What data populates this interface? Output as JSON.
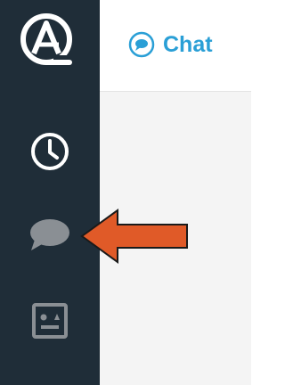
{
  "header": {
    "title": "Chat"
  },
  "sidebar": {
    "items": [
      {
        "icon": "clock-icon",
        "active": false
      },
      {
        "icon": "chat-bubble-icon",
        "active": true
      },
      {
        "icon": "contact-card-icon",
        "active": false
      }
    ]
  },
  "colors": {
    "sidebar_bg": "#1f2d38",
    "icon_white": "#ffffff",
    "icon_grey": "#8a8f94",
    "accent_blue": "#2a9fd6",
    "arrow_orange": "#e05a28",
    "content_bg": "#f4f4f4"
  },
  "annotation": {
    "arrow_icon": "pointer-arrow-icon",
    "arrow_direction": "left"
  }
}
